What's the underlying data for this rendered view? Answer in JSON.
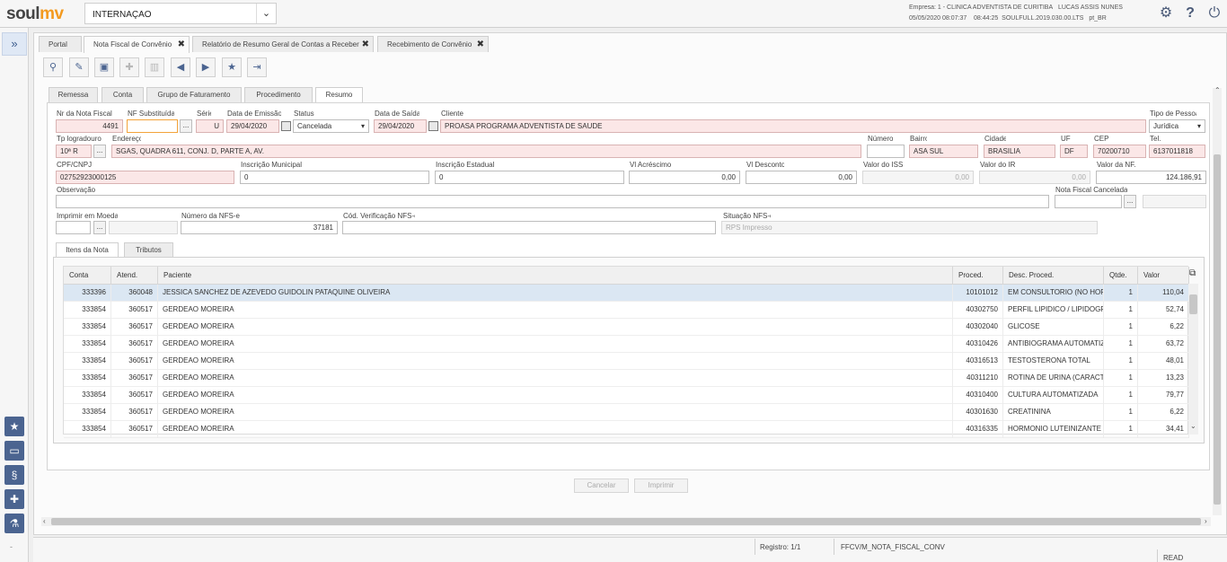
{
  "app": {
    "logo": {
      "soul": "soul",
      "mv": "mv"
    },
    "module": "INTERNAÇÃO",
    "session": {
      "empresa": "Empresa: 1 - CLINICA ADVENTISTA DE CURITIBA",
      "user": "LUCAS ASSIS NUNES",
      "datetime": "05/05/2020 08:07:37",
      "time2": "08:44:25",
      "version": "SOULFULL.2019.030.00.LTS",
      "locale": "pt_BR"
    }
  },
  "tabs": [
    {
      "label": "Portal",
      "closable": false
    },
    {
      "label": "Nota Fiscal de Convênio",
      "closable": true
    },
    {
      "label": "Relatório de Resumo Geral de Contas a Receber",
      "closable": true
    },
    {
      "label": "Recebimento de Convênio",
      "closable": true
    }
  ],
  "close_glyph": "✖",
  "subtabs": [
    "Remessa",
    "Conta",
    "Grupo de Faturamento",
    "Procedimento",
    "Resumo"
  ],
  "form": {
    "nr_nota": {
      "label": "Nr da Nota Fiscal",
      "value": "4491"
    },
    "nf_subst": {
      "label": "NF Substituída",
      "value": ""
    },
    "serie": {
      "label": "Série",
      "value": "U"
    },
    "data_emissao": {
      "label": "Data de Emissão",
      "value": "29/04/2020"
    },
    "status": {
      "label": "Status",
      "value": "Cancelada"
    },
    "data_saida": {
      "label": "Data de Saída",
      "value": "29/04/2020"
    },
    "cliente": {
      "label": "Cliente",
      "value": "PROASA PROGRAMA ADVENTISTA DE SAUDE"
    },
    "tipo_pessoa": {
      "label": "Tipo de Pessoa",
      "value": "Jurídica"
    },
    "tp_logradouro": {
      "label": "Tp logradouro",
      "value": "10ª R"
    },
    "endereco": {
      "label": "Endereço",
      "value": "SGAS, QUADRA 611, CONJ. D, PARTE A, AV."
    },
    "numero": {
      "label": "Número",
      "value": ""
    },
    "bairro": {
      "label": "Bairro",
      "value": "ASA SUL"
    },
    "cidade": {
      "label": "Cidade",
      "value": "BRASILIA"
    },
    "uf": {
      "label": "UF",
      "value": "DF"
    },
    "cep": {
      "label": "CEP",
      "value": "70200710"
    },
    "tel": {
      "label": "Tel.",
      "value": "6137011818"
    },
    "cpf_cnpj": {
      "label": "CPF/CNPJ",
      "value": "02752923000125"
    },
    "insc_municipal": {
      "label": "Inscrição Municipal",
      "value": "0"
    },
    "insc_estadual": {
      "label": "Inscrição Estadual",
      "value": "0"
    },
    "vl_acrescimo": {
      "label": "Vl Acréscimo",
      "value": "0,00"
    },
    "vl_desconto": {
      "label": "Vl Desconto",
      "value": "0,00"
    },
    "valor_iss": {
      "label": "Valor do ISS",
      "value": "0,00"
    },
    "valor_ir": {
      "label": "Valor do IR",
      "value": "0,00"
    },
    "valor_nf": {
      "label": "Valor da NF.",
      "value": "124.186,91"
    },
    "observacao": {
      "label": "Observação",
      "value": ""
    },
    "nf_cancelada": {
      "label": "Nota Fiscal Cancelada",
      "value": ""
    },
    "imprimir_moeda": {
      "label": "Imprimir em Moeda",
      "value": ""
    },
    "numero_nfse": {
      "label": "Número da NFS-e",
      "value": "37181"
    },
    "cod_verif": {
      "label": "Cód. Verificação NFS-e",
      "value": ""
    },
    "situacao_nfse": {
      "label": "Situação NFS-e",
      "value": "RPS Impresso"
    }
  },
  "item_tabs": [
    "Itens da Nota",
    "Tributos"
  ],
  "grid": {
    "headers": [
      "Conta",
      "Atend.",
      "Paciente",
      "Proced.",
      "Desc. Proced.",
      "Qtde.",
      "Valor"
    ],
    "rows": [
      [
        "333396",
        "360048",
        "JESSICA SANCHEZ DE AZEVEDO GUIDOLIN PATAQUINE OLIVEIRA",
        "10101012",
        "EM CONSULTORIO (NO HORA",
        "1",
        "110,04"
      ],
      [
        "333854",
        "360517",
        "GERDEAO MOREIRA",
        "40302750",
        "PERFIL LIPIDICO / LIPIDOGR",
        "1",
        "52,74"
      ],
      [
        "333854",
        "360517",
        "GERDEAO MOREIRA",
        "40302040",
        "GLICOSE",
        "1",
        "6,22"
      ],
      [
        "333854",
        "360517",
        "GERDEAO MOREIRA",
        "40310426",
        "ANTIBIOGRAMA AUTOMATIZ/",
        "1",
        "63,72"
      ],
      [
        "333854",
        "360517",
        "GERDEAO MOREIRA",
        "40316513",
        "TESTOSTERONA TOTAL",
        "1",
        "48,01"
      ],
      [
        "333854",
        "360517",
        "GERDEAO MOREIRA",
        "40311210",
        "ROTINA DE URINA (CARACTE",
        "1",
        "13,23"
      ],
      [
        "333854",
        "360517",
        "GERDEAO MOREIRA",
        "40310400",
        "CULTURA AUTOMATIZADA",
        "1",
        "79,77"
      ],
      [
        "333854",
        "360517",
        "GERDEAO MOREIRA",
        "40301630",
        "CREATININA",
        "1",
        "6,22"
      ],
      [
        "333854",
        "360517",
        "GERDEAO MOREIRA",
        "40316335",
        "HORMONIO LUTEINIZANTE (I",
        "1",
        "34,41"
      ]
    ]
  },
  "buttons": {
    "cancelar": "Cancelar",
    "imprimir": "Imprimir"
  },
  "status": {
    "registro": "Registro: 1/1",
    "form_name": "FFCV/M_NOTA_FISCAL_CONV",
    "mode": "READ"
  },
  "icons": {
    "search": "search-icon",
    "brush": "brush-icon",
    "save": "save-icon",
    "add": "add-icon",
    "delete": "delete-icon",
    "prev": "prev-icon",
    "next": "next-icon",
    "favorite": "star-icon",
    "export": "export-icon"
  },
  "colors": {
    "accent": "#f39a1f",
    "rail": "#4b6490",
    "required": "#fbe7e7",
    "selected_row": "#dbe7f3"
  }
}
